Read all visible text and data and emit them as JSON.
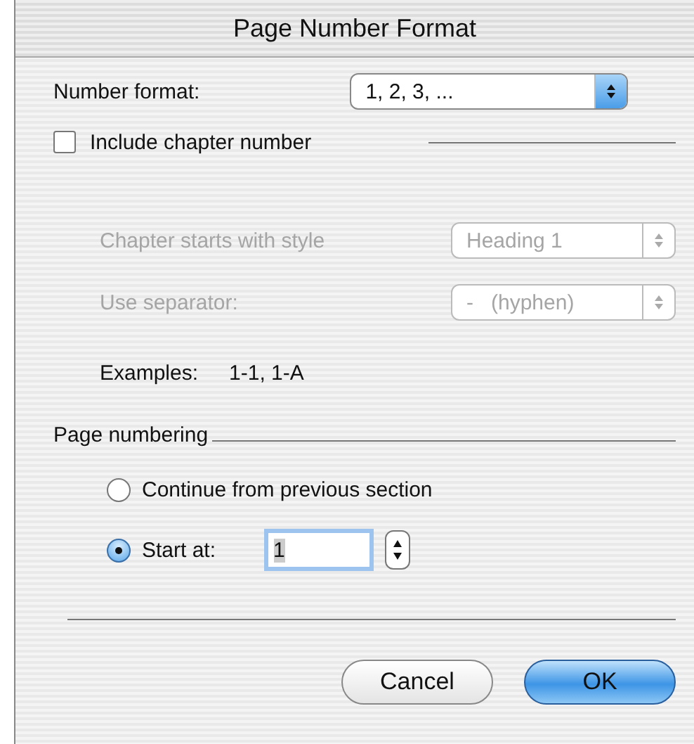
{
  "window": {
    "title": "Page Number Format"
  },
  "number_format": {
    "label": "Number format:",
    "value": "1, 2, 3, ..."
  },
  "include_chapter": {
    "label": "Include chapter number",
    "checked": false
  },
  "chapter_options": [
    {
      "label": "Chapter starts with style",
      "value": "Heading 1",
      "disabled": true
    },
    {
      "label": "Use separator:",
      "value": "-   (hyphen)",
      "disabled": true
    }
  ],
  "examples": {
    "label": "Examples:",
    "value": "1-1, 1-A"
  },
  "page_numbering": {
    "heading": "Page numbering",
    "options": [
      {
        "label": "Continue from previous section",
        "selected": false
      },
      {
        "label": "Start at:",
        "selected": true,
        "value": "1"
      }
    ]
  },
  "buttons": [
    {
      "label": "Cancel",
      "default": false
    },
    {
      "label": "OK",
      "default": true
    }
  ]
}
